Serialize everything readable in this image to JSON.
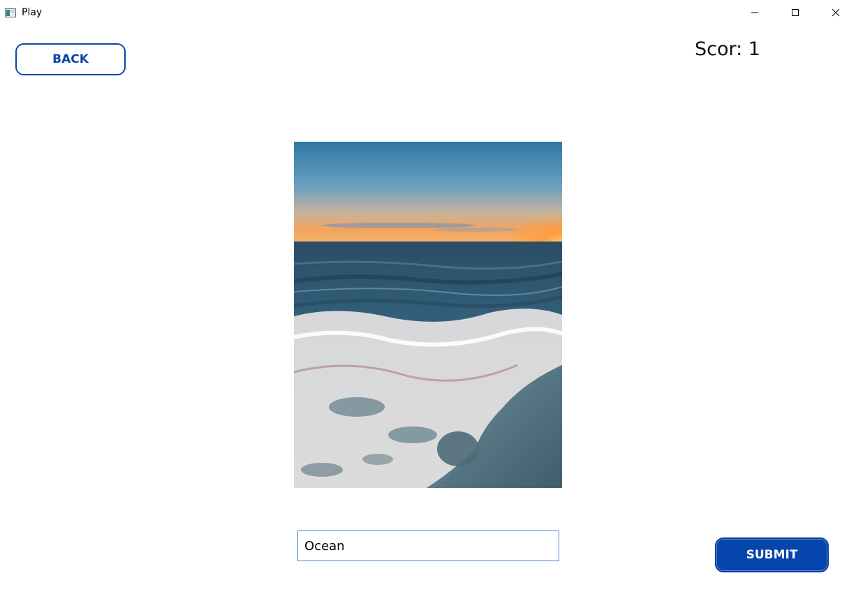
{
  "window": {
    "title": "Play",
    "icon": "app-window-icon"
  },
  "controls": {
    "minimize_icon": "minimize-icon",
    "maximize_icon": "maximize-icon",
    "close_icon": "close-icon"
  },
  "game": {
    "back_label": "BACK",
    "score_text": "Scor: 1",
    "submit_label": "SUBMIT",
    "answer_value": "Ocean",
    "photo_subject": "ocean-waves-sunset-photo"
  },
  "colors": {
    "accent": "#0645ad",
    "input_border": "#4a86c8"
  }
}
